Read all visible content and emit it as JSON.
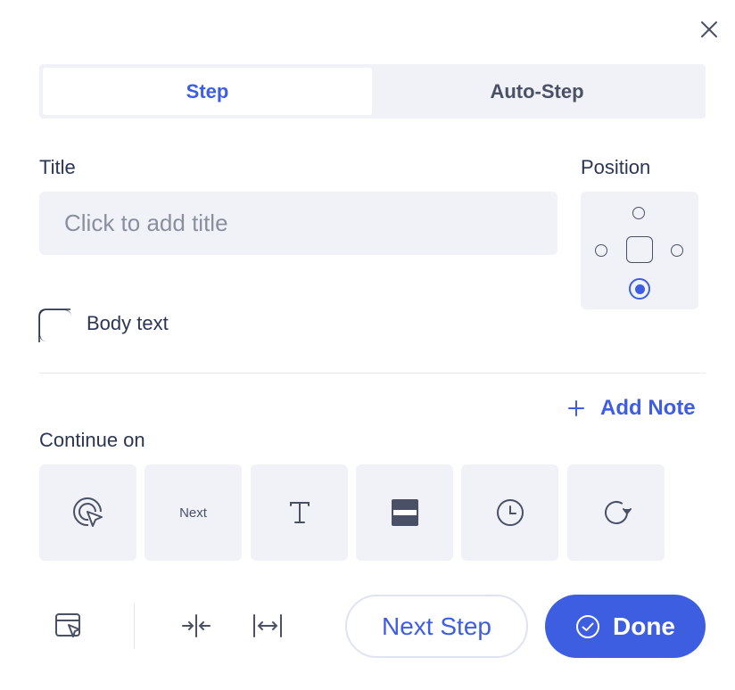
{
  "colors": {
    "accent": "#3d5ee1",
    "text": "#2b3556",
    "muted": "#8a8f9e",
    "surface": "#f1f2f7"
  },
  "header": {
    "close_icon": "close-icon"
  },
  "tabs": [
    {
      "label": "Step",
      "active": true
    },
    {
      "label": "Auto-Step",
      "active": false
    }
  ],
  "title_field": {
    "label": "Title",
    "placeholder": "Click to add title",
    "value": ""
  },
  "position": {
    "label": "Position",
    "options": [
      "top",
      "left",
      "center",
      "right",
      "bottom"
    ],
    "selected": "bottom"
  },
  "body_text": {
    "label": "Body text",
    "checked": false
  },
  "add_note": {
    "label": "Add Note",
    "icon": "plus-icon"
  },
  "continue_on": {
    "label": "Continue on",
    "options": [
      {
        "icon": "click-target-icon"
      },
      {
        "label": "Next"
      },
      {
        "icon": "text-input-icon"
      },
      {
        "icon": "widget-icon"
      },
      {
        "icon": "clock-icon"
      },
      {
        "icon": "refresh-icon"
      }
    ]
  },
  "footer": {
    "icons": [
      "select-element-icon",
      "collapse-width-icon",
      "expand-width-icon"
    ],
    "next_step_label": "Next Step",
    "done_label": "Done"
  }
}
